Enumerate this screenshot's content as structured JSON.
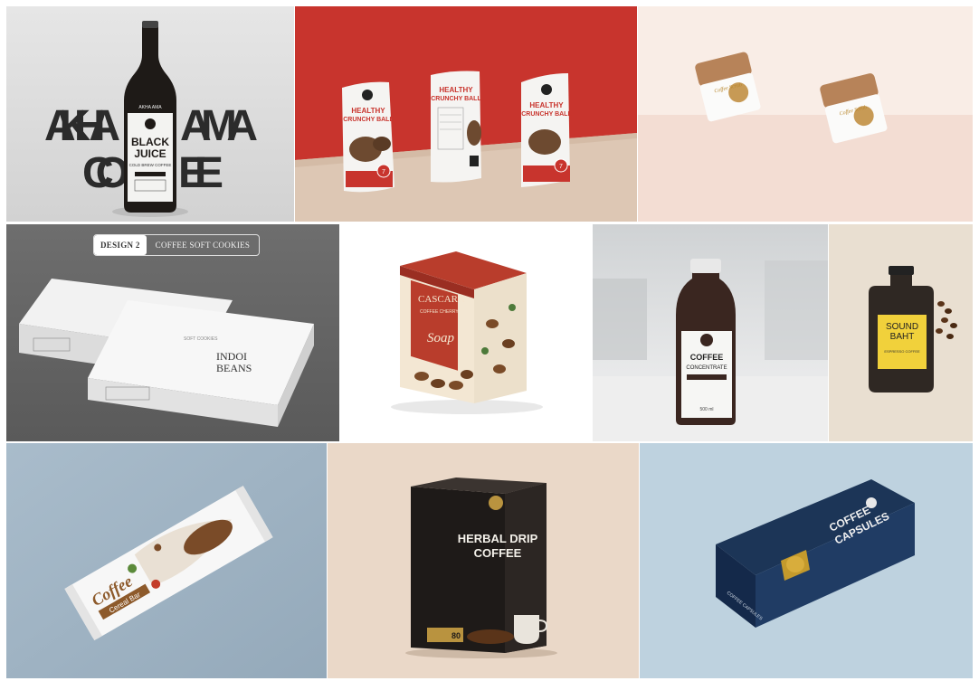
{
  "tiles": {
    "akha": {
      "word_top": "AKHA",
      "word_top_right": "AMA",
      "word_bottom_left": "CO",
      "word_bottom_right": "EE",
      "label_brand": "AKHA AMA",
      "label_title_1": "BLACK",
      "label_title_2": "JUICE",
      "label_sub": "COLD BREW COFFEE"
    },
    "crunchy": {
      "title_1": "HEALTHY",
      "title_2": "CRUNCHY BALL",
      "badge": "7"
    },
    "scrub": {
      "label": "Coffee Scrub"
    },
    "cookies": {
      "tag_design": "DESIGN 2",
      "tag_name": "COFFEE SOFT COOKIES",
      "box_text_1": "INDOI",
      "box_text_2": "BEANS",
      "side_text": "SOFT COOKIES"
    },
    "cascara": {
      "name": "CASCARA",
      "sub": "COFFEE CHERRY",
      "product": "Soap"
    },
    "concentrate": {
      "title": "COFFEE",
      "sub": "CONCENTRATE",
      "volume": "500 ml"
    },
    "soundbaht": {
      "name_1": "SOUND",
      "name_2": "BAHT",
      "sub": "ESPRESSO COFFEE"
    },
    "bar": {
      "word": "Coffee",
      "sub": "Cereal Bar"
    },
    "herbal": {
      "title_1": "HERBAL DRIP",
      "title_2": "COFFEE",
      "badge": "80"
    },
    "capsules": {
      "title_1": "COFFEE",
      "title_2": "CAPSULES",
      "side": "COFFEE CAPSULES"
    }
  },
  "colors": {
    "red_wall": "#c8342d",
    "cream": "#f7e9e3",
    "blue_grey": "#9fb3c4",
    "sky": "#bed2df"
  }
}
